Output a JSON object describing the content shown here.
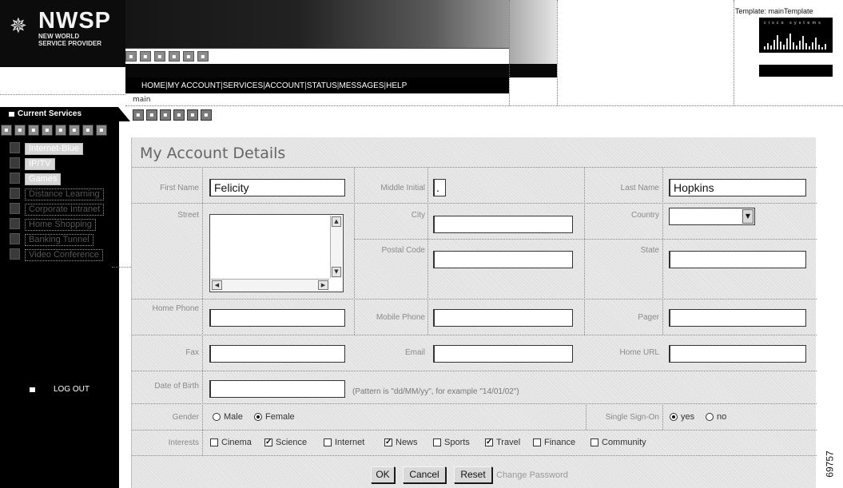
{
  "brand": {
    "logo_name": "NWSP",
    "logo_line1": "NEW WORLD",
    "logo_line2": "SERVICE PROVIDER",
    "icon": "star-burst-icon"
  },
  "nav": {
    "items": [
      "HOME",
      "MY ACCOUNT",
      "SERVICES",
      "ACCOUNT",
      "STATUS",
      "MESSAGES",
      "HELP"
    ],
    "separator": "|"
  },
  "template": {
    "label": "Template: mainTemplate",
    "partner_logo_text": "cisco systems"
  },
  "main_label": "main",
  "sidebar": {
    "header": "Current Services",
    "services": [
      {
        "label": "Internet-Blue",
        "highlighted": true
      },
      {
        "label": "IP/TV",
        "highlighted": true
      },
      {
        "label": "Games",
        "highlighted": true
      },
      {
        "label": "Distance Learning",
        "highlighted": false
      },
      {
        "label": "Corporate Intranet",
        "highlighted": false
      },
      {
        "label": "Home Shopping",
        "highlighted": false
      },
      {
        "label": "Banking Tunnel",
        "highlighted": false
      },
      {
        "label": "Video Conference",
        "highlighted": false
      }
    ],
    "logout": "LOG OUT"
  },
  "form": {
    "title": "My Account Details",
    "labels": {
      "first_name": "First Name",
      "middle_initial": "Middle Initial",
      "last_name": "Last Name",
      "street": "Street",
      "city": "City",
      "country": "Country",
      "postal_code": "Postal Code",
      "state": "State",
      "home_phone": "Home Phone",
      "mobile_phone": "Mobile Phone",
      "pager": "Pager",
      "fax": "Fax",
      "email": "Email",
      "home_url": "Home URL",
      "dob": "Date of Birth",
      "gender": "Gender",
      "sso": "Single Sign-On",
      "interests": "Interests"
    },
    "values": {
      "first_name": "Felicity",
      "middle_initial": ".",
      "last_name": "Hopkins",
      "street": "",
      "city": "",
      "country": "",
      "postal_code": "",
      "state": "",
      "home_phone": "",
      "mobile_phone": "",
      "pager": "",
      "fax": "",
      "email": "",
      "home_url": "",
      "dob": ""
    },
    "dob_hint": "(Pattern is \"dd/MM/yy\", for example \"14/01/02\")",
    "gender": {
      "options": [
        "Male",
        "Female"
      ],
      "selected": "Female"
    },
    "sso": {
      "options": [
        "yes",
        "no"
      ],
      "selected": "yes"
    },
    "interests": [
      {
        "label": "Cinema",
        "checked": false
      },
      {
        "label": "Science",
        "checked": true
      },
      {
        "label": "Internet",
        "checked": false
      },
      {
        "label": "News",
        "checked": true
      },
      {
        "label": "Sports",
        "checked": false
      },
      {
        "label": "Travel",
        "checked": true
      },
      {
        "label": "Finance",
        "checked": false
      },
      {
        "label": "Community",
        "checked": false
      }
    ],
    "buttons": {
      "ok": "OK",
      "cancel": "Cancel",
      "reset": "Reset",
      "change_password": "Change Password"
    }
  },
  "figure_id": "69757"
}
